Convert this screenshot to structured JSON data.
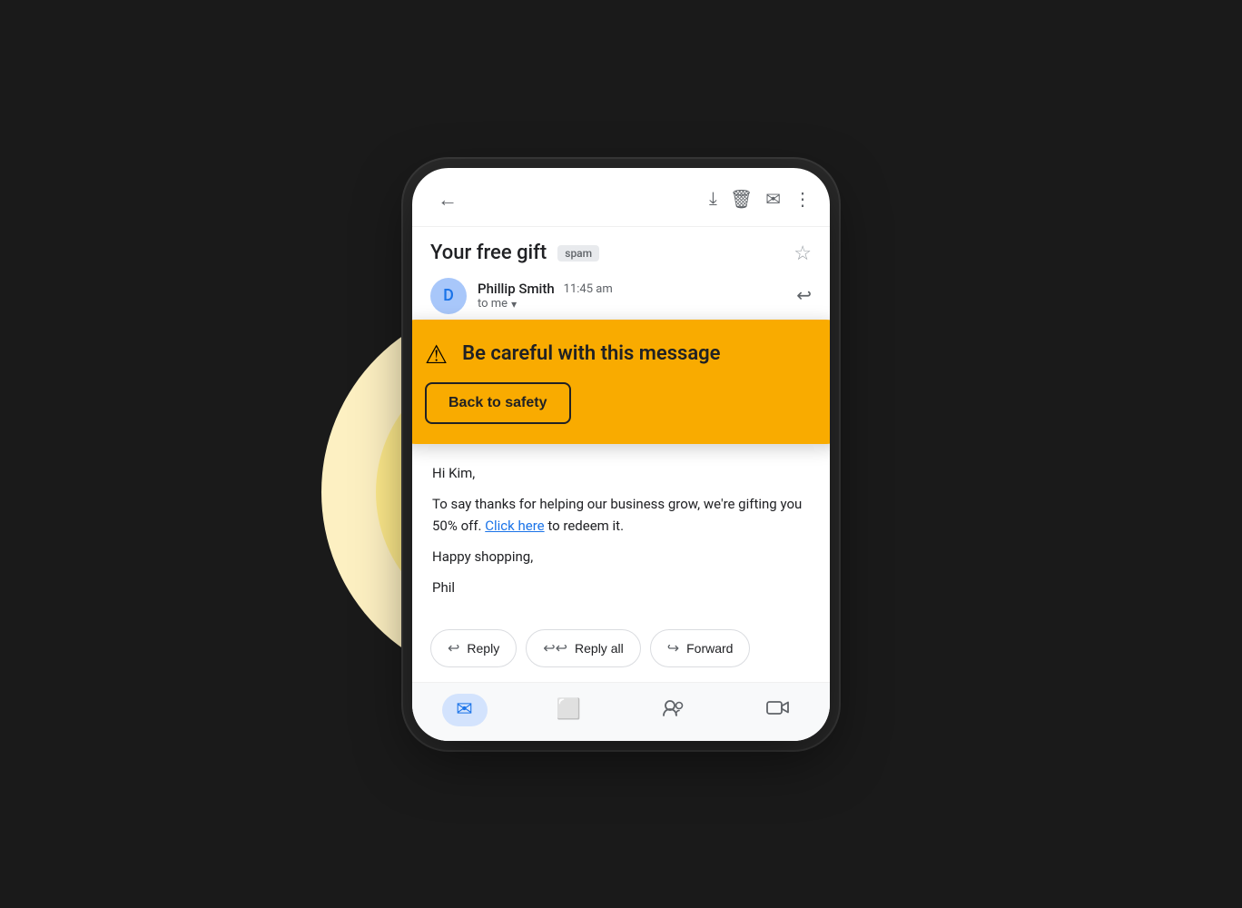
{
  "scene": {
    "background": "#1a1a1a"
  },
  "phone": {
    "topbar": {
      "back_icon": "←",
      "download_icon": "⬇",
      "delete_icon": "🗑",
      "email_icon": "✉",
      "more_icon": "⋮"
    },
    "email": {
      "title": "Your free gift",
      "spam_label": "spam",
      "star_icon": "☆",
      "sender_initial": "D",
      "sender_name": "Phillip Smith",
      "send_time": "11:45 am",
      "to_label": "to me",
      "reply_icon": "↩",
      "body_greeting": "Hi Kim,",
      "body_line1": "To say thanks for helping our business grow, we're gifting you 50% off.",
      "body_link": "Click here",
      "body_line2": " to redeem it.",
      "body_closing": "Happy shopping,",
      "body_signature": "Phil"
    },
    "warning": {
      "icon": "⚠",
      "title": "Be careful with this message",
      "back_safety_label": "Back to safety"
    },
    "actions": {
      "reply_label": "Reply",
      "reply_all_label": "Reply all",
      "forward_label": "Forward",
      "reply_icon": "↩",
      "reply_all_icon": "↩↩",
      "forward_icon": "↪"
    },
    "bottom_nav": {
      "mail_icon": "✉",
      "chat_icon": "💬",
      "meet_icon": "👥",
      "video_icon": "📹"
    }
  }
}
